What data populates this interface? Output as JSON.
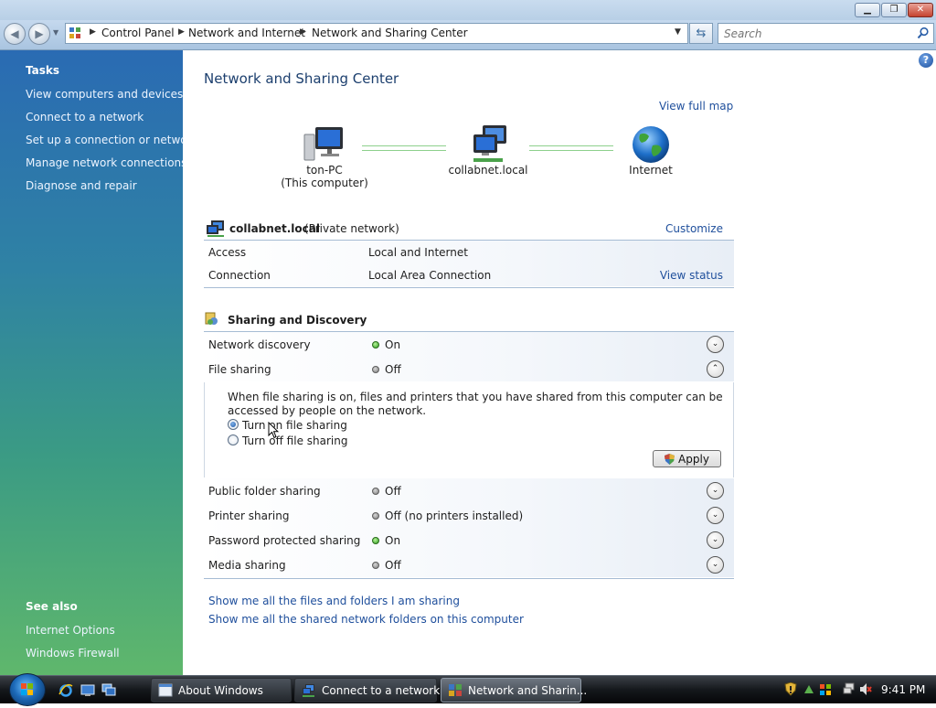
{
  "window": {
    "minimize": "▁",
    "maximize": "❐",
    "close": "✕"
  },
  "address": {
    "crumbs": [
      "Control Panel",
      "Network and Internet",
      "Network and Sharing Center"
    ],
    "search_placeholder": "Search"
  },
  "sidebar": {
    "tasks_heading": "Tasks",
    "tasks": [
      "View computers and devices",
      "Connect to a network",
      "Set up a connection or network",
      "Manage network connections",
      "Diagnose and repair"
    ],
    "see_also_heading": "See also",
    "see_also": [
      "Internet Options",
      "Windows Firewall"
    ]
  },
  "main": {
    "title": "Network and Sharing Center",
    "help": "?",
    "view_full_map": "View full map",
    "map": {
      "computer": {
        "name": "ton-PC",
        "subtitle": "(This computer)"
      },
      "network": {
        "name": "collabnet.local"
      },
      "internet": {
        "name": "Internet"
      }
    },
    "network": {
      "name": "collabnet.local",
      "type": "(Private network)",
      "customize": "Customize",
      "details": [
        {
          "label": "Access",
          "value": "Local and Internet",
          "link": ""
        },
        {
          "label": "Connection",
          "value": "Local Area Connection",
          "link": "View status"
        }
      ]
    },
    "sharing": {
      "heading": "Sharing and Discovery",
      "rows": [
        {
          "label": "Network discovery",
          "status": "On",
          "state": "on"
        },
        {
          "label": "File sharing",
          "status": "Off",
          "state": "off"
        },
        {
          "label": "Public folder sharing",
          "status": "Off",
          "state": "off"
        },
        {
          "label": "Printer sharing",
          "status": "Off (no printers installed)",
          "state": "off"
        },
        {
          "label": "Password protected sharing",
          "status": "On",
          "state": "on"
        },
        {
          "label": "Media sharing",
          "status": "Off",
          "state": "off"
        }
      ],
      "file_sharing_panel": {
        "description": "When file sharing is on, files and printers that you have shared from this computer can be accessed by people on the network.",
        "option_on": "Turn on file sharing",
        "option_off": "Turn off file sharing",
        "selected": "on",
        "apply": "Apply"
      }
    },
    "links": [
      "Show me all the files and folders I am sharing",
      "Show me all the shared network folders on this computer"
    ]
  },
  "taskbar": {
    "buttons": [
      {
        "label": "About Windows",
        "active": false
      },
      {
        "label": "Connect to a network",
        "active": false
      },
      {
        "label": "Network and Sharin...",
        "active": true
      }
    ],
    "clock": "9:41 PM"
  },
  "colors": {
    "link": "#1f4f9c",
    "status_on": "#2d9b1e",
    "status_off": "#7a7a7a",
    "title": "#1c3f6e"
  }
}
